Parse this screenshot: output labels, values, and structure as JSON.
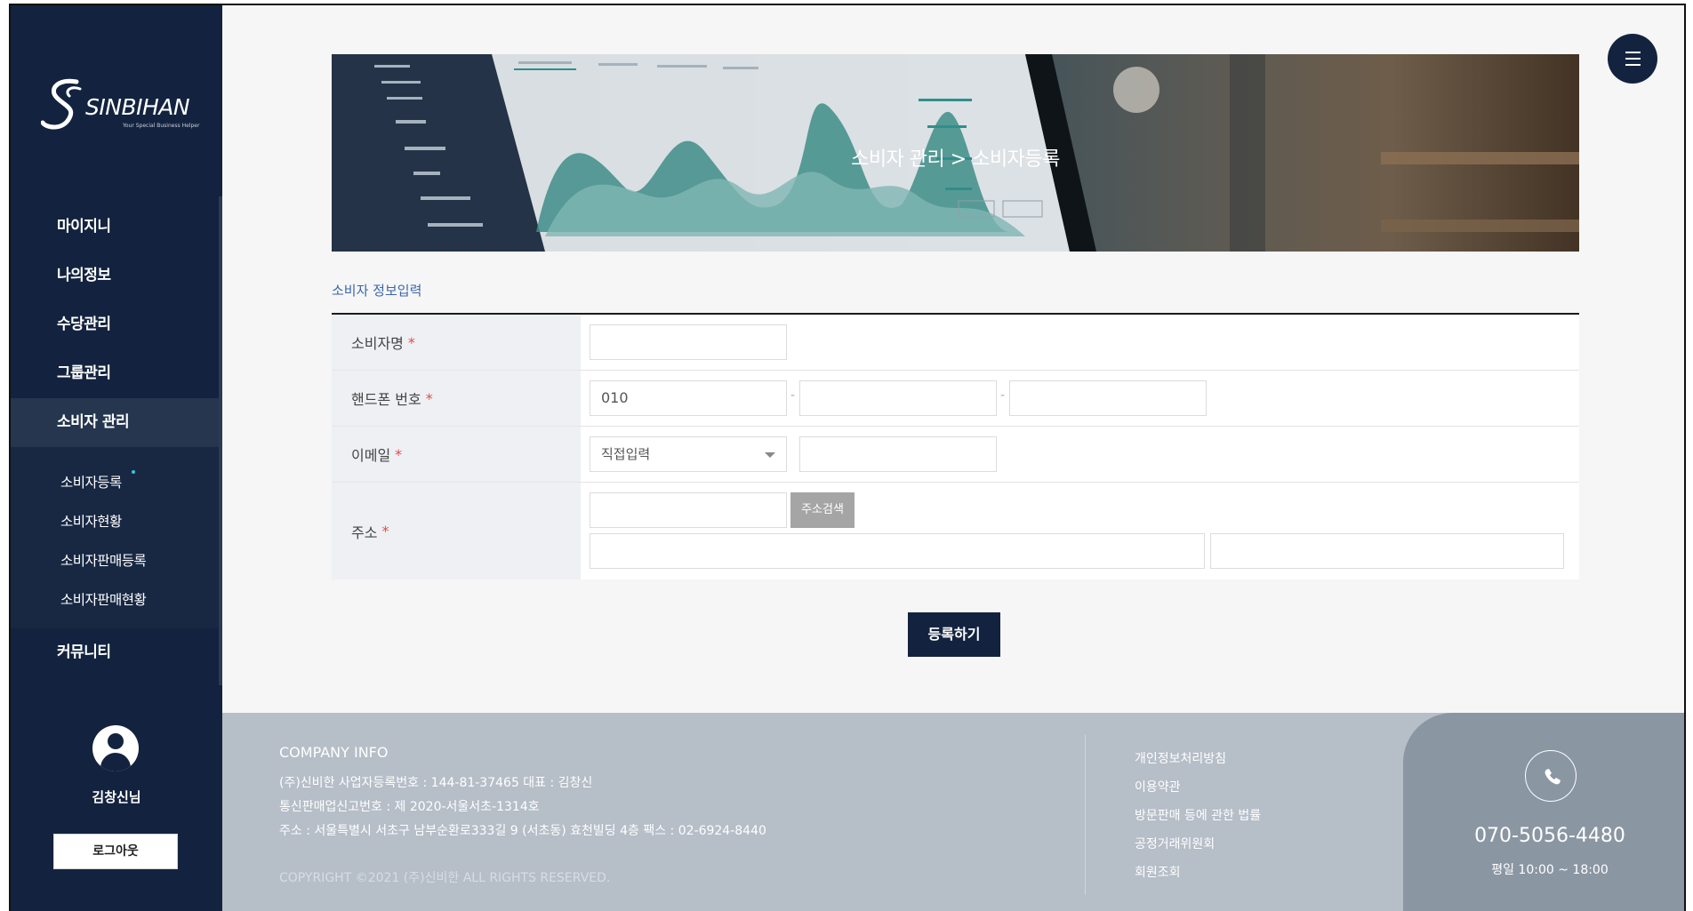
{
  "brand": {
    "name": "SINBIHAN",
    "tagline": "Your Special Business Helper"
  },
  "sidebar": {
    "items": [
      {
        "label": "마이지니"
      },
      {
        "label": "나의정보"
      },
      {
        "label": "수당관리"
      },
      {
        "label": "그룹관리"
      },
      {
        "label": "소비자 관리",
        "active": true
      },
      {
        "label": "커뮤니티"
      }
    ],
    "sub_items": [
      {
        "label": "소비자등록",
        "active": true
      },
      {
        "label": "소비자현황"
      },
      {
        "label": "소비자판매등록"
      },
      {
        "label": "소비자판매현황"
      }
    ],
    "user_name": "김창신님",
    "logout_label": "로그아웃"
  },
  "banner": {
    "breadcrumb": "소비자 관리 > 소비자등록"
  },
  "form": {
    "section_title": "소비자 정보입력",
    "name_label": "소비자명",
    "phone_label": "핸드폰 번호",
    "phone_prefix": "010",
    "email_label": "이메일",
    "email_select": "직접입력",
    "address_label": "주소",
    "address_search_label": "주소검색",
    "required_mark": "*",
    "dash": "-",
    "submit_label": "등록하기"
  },
  "footer": {
    "title": "COMPANY INFO",
    "line1": "(주)신비한   사업자등록번호 : 144-81-37465   대표 : 김창신",
    "line2": "통신판매업신고번호 : 제 2020-서울서초-1314호",
    "line3": "주소 : 서울특별시 서초구 남부순환로333길 9 (서초동) 효천빌딩 4층   팩스 : 02-6924-8440",
    "copyright": "COPYRIGHT ©2021 (주)신비한 ALL RIGHTS RESERVED.",
    "links": [
      "개인정보처리방침",
      "이용약관",
      "방문판매 등에 관한 법률",
      "공정거래위원회",
      "회원조회"
    ],
    "phone": "070-5056-4480",
    "hours": "평일 10:00 ~ 18:00"
  },
  "colors": {
    "navy": "#13233f",
    "accent_blue": "#3b67a9",
    "required_red": "#e04b4b",
    "footer_gray": "#b6bec8"
  }
}
